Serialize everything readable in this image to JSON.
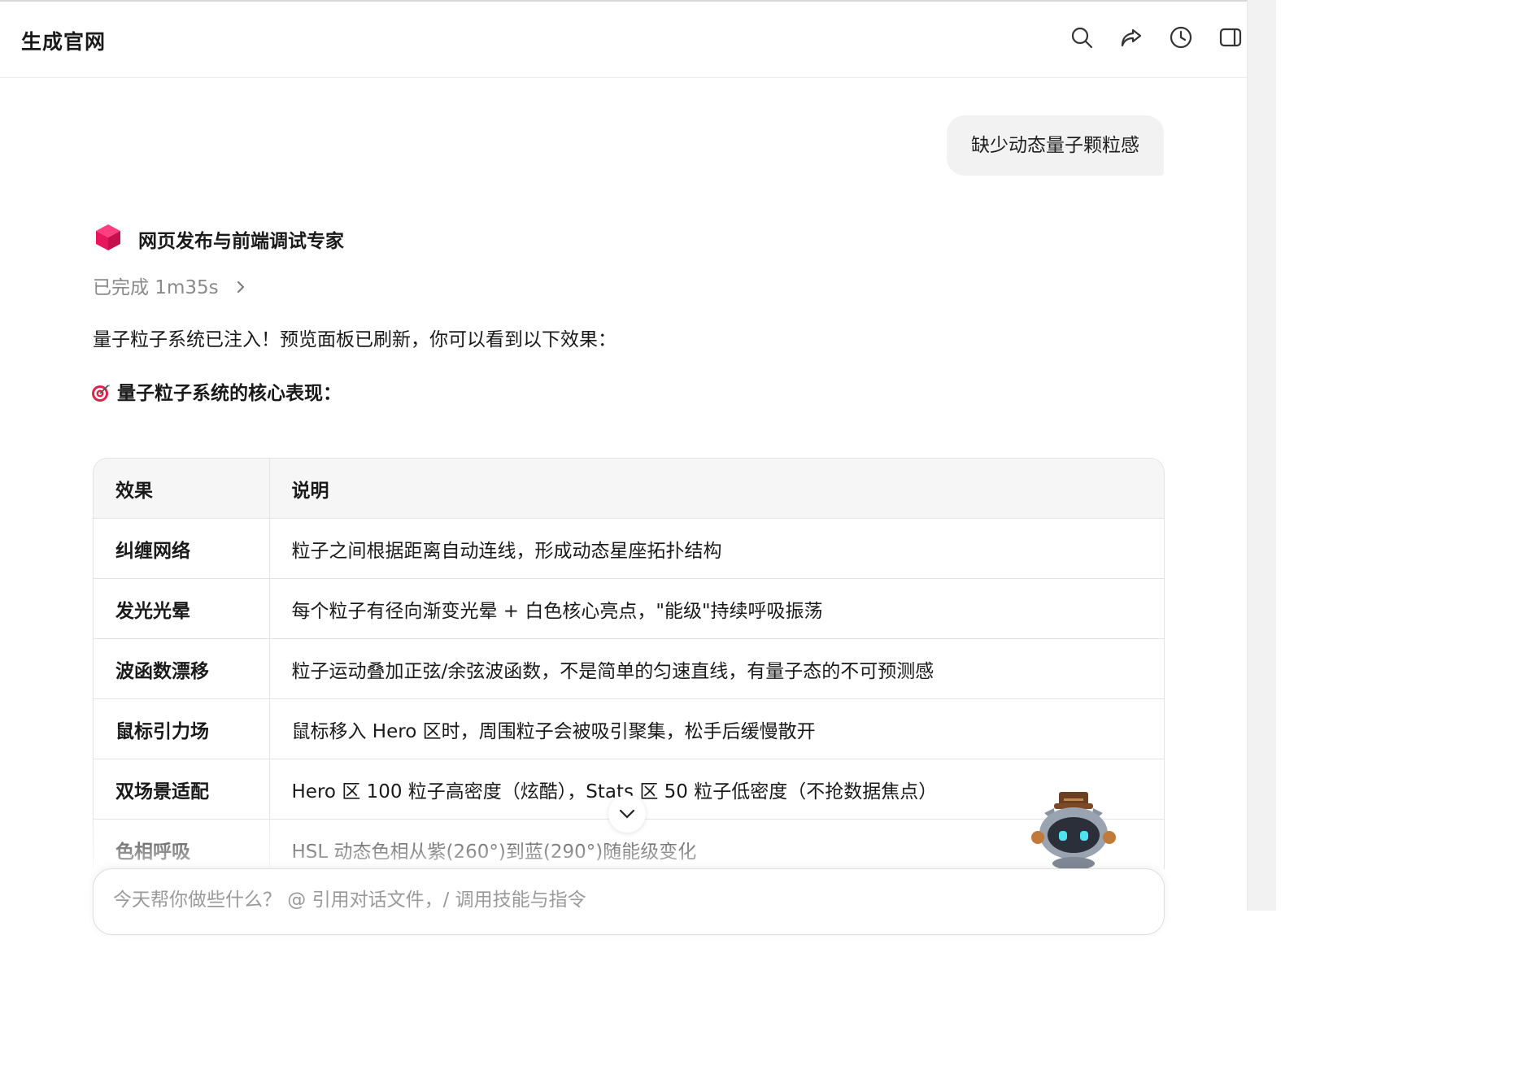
{
  "header": {
    "title": "生成官网",
    "icons": [
      "search-icon",
      "share-icon",
      "history-icon",
      "sidebar-toggle-icon"
    ]
  },
  "user_message": "缺少动态量子颗粒感",
  "agent": {
    "name": "网页发布与前端调试专家",
    "icon": "cube-icon",
    "status": "已完成 1m35s"
  },
  "reply": {
    "intro": "量子粒子系统已注入！预览面板已刷新，你可以看到以下效果：",
    "section_title": "量子粒子系统的核心表现：",
    "table": {
      "headers": [
        "效果",
        "说明"
      ],
      "rows": [
        [
          "纠缠网络",
          "粒子之间根据距离自动连线，形成动态星座拓扑结构"
        ],
        [
          "发光光晕",
          "每个粒子有径向渐变光晕 + 白色核心亮点，\"能级\"持续呼吸振荡"
        ],
        [
          "波函数漂移",
          "粒子运动叠加正弦/余弦波函数，不是简单的匀速直线，有量子态的不可预测感"
        ],
        [
          "鼠标引力场",
          "鼠标移入 Hero 区时，周围粒子会被吸引聚集，松手后缓慢散开"
        ],
        [
          "双场景适配",
          "Hero 区 100 粒子高密度（炫酷），Stats 区 50 粒子低密度（不抢数据焦点）"
        ],
        [
          "色相呼吸",
          "HSL 动态色相从紫(260°)到蓝(290°)随能级变化"
        ]
      ]
    }
  },
  "composer": {
    "placeholder": "今天帮你做些什么？ @ 引用对话文件，/ 调用技能与指令"
  },
  "colors": {
    "cube": "#e8175d",
    "bubble": "#f2f2f2",
    "header_cell": "#f6f6f6"
  }
}
